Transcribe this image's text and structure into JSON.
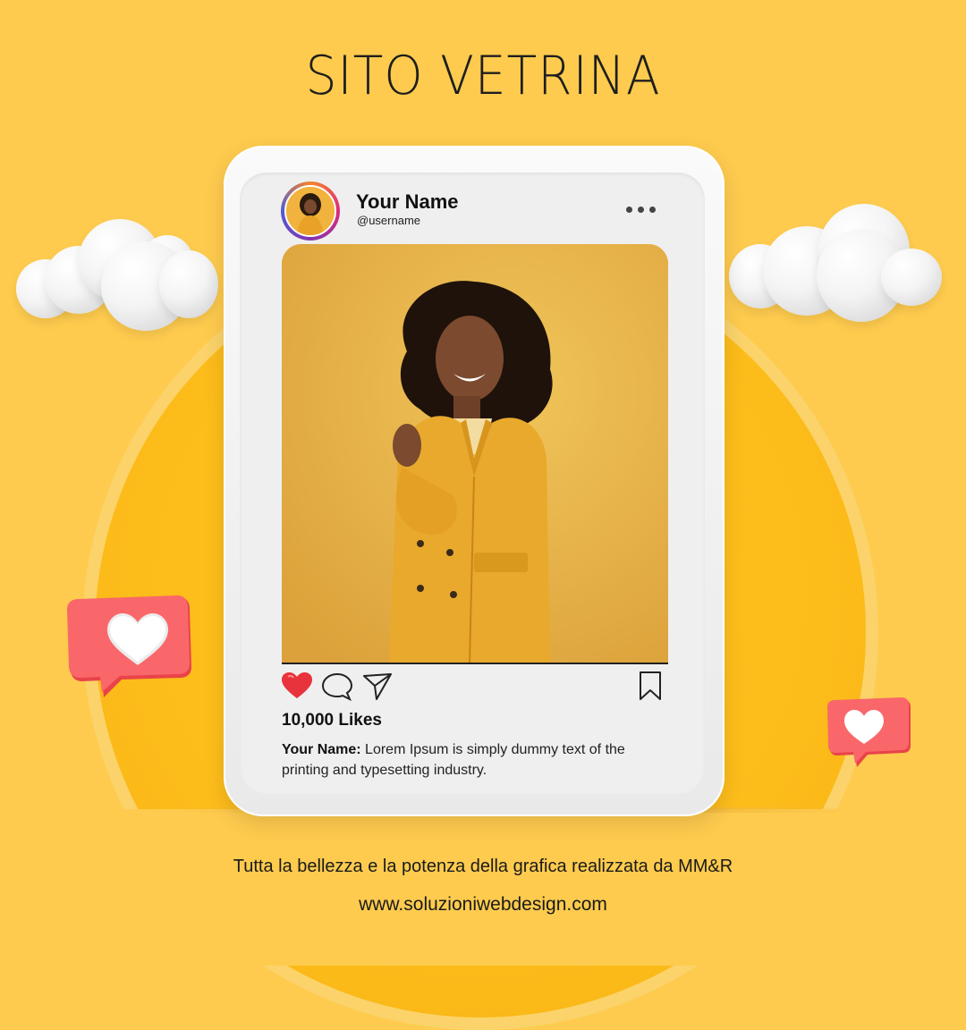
{
  "title": "SITO VETRINA",
  "post": {
    "name": "Your Name",
    "username": "@username",
    "likes": "10,000 Likes",
    "caption_author": "Your Name:",
    "caption_text": " Lorem Ipsum is simply dummy text of the printing and typesetting industry."
  },
  "footer": {
    "tagline": "Tutta la bellezza e la potenza della grafica realizzata da MM&R",
    "website": "www.soluzioniwebdesign.com"
  },
  "colors": {
    "background": "#fecb4e",
    "circle": "#fdbd1b",
    "heart_bubble": "#f05a5e",
    "like_heart": "#e8323c"
  },
  "icons": [
    "more-dots-icon",
    "heart-icon",
    "comment-icon",
    "send-icon",
    "bookmark-icon",
    "heart-bubble-icon",
    "cloud-icon"
  ]
}
